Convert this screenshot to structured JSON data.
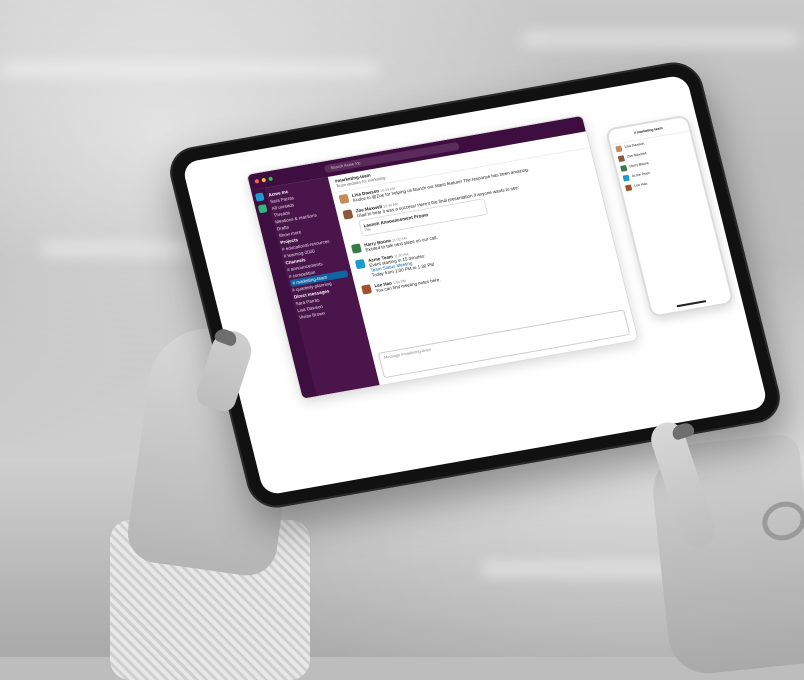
{
  "workspace": {
    "name": "Acme Inc",
    "user": "Sara Parras"
  },
  "search": {
    "placeholder": "Search Acme Inc"
  },
  "sidebar": {
    "items": [
      {
        "label": "All unreads"
      },
      {
        "label": "Threads"
      },
      {
        "label": "Mentions & reactions"
      },
      {
        "label": "Drafts"
      },
      {
        "label": "Show more"
      }
    ],
    "sections": [
      {
        "title": "Projects",
        "channels": [
          "# educational-resources",
          "# learning-2020"
        ]
      },
      {
        "title": "Channels",
        "channels": [
          "# announcements",
          "# competition",
          "# marketing-team",
          "# quarterly-planning"
        ]
      },
      {
        "title": "Direct messages",
        "channels": [
          "Sara Parras",
          "Lisa Dawson",
          "Vivian Brown"
        ]
      }
    ],
    "active_channel": "# marketing-team"
  },
  "channel": {
    "name": "#marketing-team",
    "topic": "Team updates for marketing"
  },
  "messages": [
    {
      "author": "Lisa Dawson",
      "time": "10:30 AM",
      "text": "Kudos to @Zoe for helping us launch our latest feature! The response has been amazing."
    },
    {
      "author": "Zoe Maxwell",
      "time": "10:34 AM",
      "text": "Glad to hear it was a success! Here's the final presentation if anyone wants to see:"
    },
    {
      "author": "Harry Boone",
      "time": "11:02 AM",
      "text": "Excited to talk next steps on our call."
    },
    {
      "author": "Acme Team",
      "time": "11:30 AM",
      "text": "Event starting in 15 minutes:"
    },
    {
      "author": "Lee Hao",
      "time": "1:04 PM",
      "text": "You can find meeting notes here."
    }
  ],
  "attachment": {
    "title": "Launch Announcement Promo",
    "type": "Flile"
  },
  "event": {
    "title": "Team Status Meeting",
    "time": "Today from 1:00 PM to 1:30 PM"
  },
  "composer": {
    "placeholder": "Message #marketing-team"
  },
  "phone": {
    "title": "# marketing-team"
  },
  "colors": {
    "sidebar": "#4a154b",
    "topbar": "#3f0e40",
    "active": "#1164a3",
    "link": "#1264a3"
  }
}
